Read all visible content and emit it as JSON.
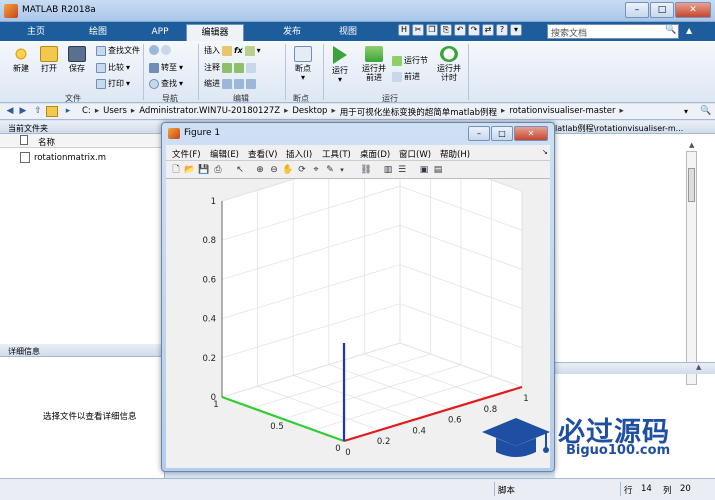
{
  "window": {
    "title": "MATLAB R2018a",
    "min": "–",
    "max": "□",
    "close": "✕"
  },
  "ribbon_tabs": [
    "主页",
    "绘图",
    "APP",
    "编辑器",
    "发布",
    "视图"
  ],
  "search": {
    "placeholder": "搜索文档"
  },
  "quick_access": [
    "H",
    "✂",
    "❐",
    "⎘",
    "↶",
    "↷",
    "⇄",
    "?",
    "▾"
  ],
  "ribbon": {
    "file": {
      "label": "文件",
      "new": "新建",
      "open": "打开",
      "save": "保存",
      "find_files": "查找文件",
      "compare": "比较",
      "print": "打印"
    },
    "navigate": {
      "label": "导航",
      "goto": "转至",
      "find": "查找"
    },
    "edit": {
      "label": "编辑",
      "insert": "插入",
      "comment": "注释",
      "indent": "缩进",
      "fx": "fx"
    },
    "breakpoints": {
      "label": "断点",
      "breakpoint": "断点"
    },
    "run": {
      "label": "运行",
      "run": "运行",
      "run_advance": "运行并\n前进",
      "run_section": "运行节",
      "advance": "前进",
      "run_time": "运行并\n计时"
    }
  },
  "address": {
    "crumbs": [
      "C:",
      "Users",
      "Administrator.WIN7U-20180127Z",
      "Desktop",
      "用于可视化坐标变换的超简单matlab例程",
      "rotationvisualiser-master"
    ]
  },
  "left_panel": {
    "current_folder": "当前文件夹",
    "name_column": "名称",
    "files": [
      "rotationmatrix.m"
    ],
    "details_title": "详细信息",
    "details_hint": "选择文件以查看详细信息"
  },
  "right_panel": {
    "header": "latlab例程\\rotationvisualiser-m..."
  },
  "status": {
    "mode": "脚本",
    "row_label": "行",
    "row": "14",
    "col_label": "列",
    "col": "20"
  },
  "figure": {
    "title": "Figure 1",
    "menus": [
      "文件(F)",
      "编辑(E)",
      "查看(V)",
      "插入(I)",
      "工具(T)",
      "桌面(D)",
      "窗口(W)",
      "帮助(H)"
    ],
    "toolbar_icons": [
      "new-icon",
      "open-icon",
      "save-icon",
      "print-icon",
      "pointer-icon",
      "zoom-in-icon",
      "zoom-out-icon",
      "pan-icon",
      "rotate-icon",
      "data-cursor-icon",
      "brush-icon",
      "link-icon",
      "colorbar-icon",
      "legend-icon",
      "hide-plot-tools-icon",
      "show-plot-tools-icon"
    ]
  },
  "chart_data": {
    "type": "line",
    "title": "",
    "xlabel": "",
    "ylabel": "",
    "zlabel": "",
    "xlim": [
      0,
      1
    ],
    "ylim": [
      0,
      1
    ],
    "zlim": [
      0,
      1
    ],
    "x_ticks": [
      "0",
      "0.2",
      "0.4",
      "0.6",
      "0.8",
      "1"
    ],
    "y_ticks": [
      "0",
      "0.5",
      "1"
    ],
    "z_ticks": [
      "0",
      "0.2",
      "0.4",
      "0.6",
      "0.8",
      "1"
    ],
    "grid": true,
    "series": [
      {
        "color": "#e31a1c",
        "x": [
          0,
          1
        ],
        "y": [
          0,
          0
        ],
        "z": [
          0,
          0
        ]
      },
      {
        "color": "#33cc33",
        "x": [
          0,
          0
        ],
        "y": [
          0,
          1
        ],
        "z": [
          0,
          0
        ]
      },
      {
        "color": "#1f2fd6",
        "x": [
          0,
          0
        ],
        "y": [
          0,
          0
        ],
        "z": [
          0,
          0.5
        ]
      }
    ]
  },
  "watermark": {
    "cn": "必过源码",
    "en": "Biguo100.com"
  }
}
